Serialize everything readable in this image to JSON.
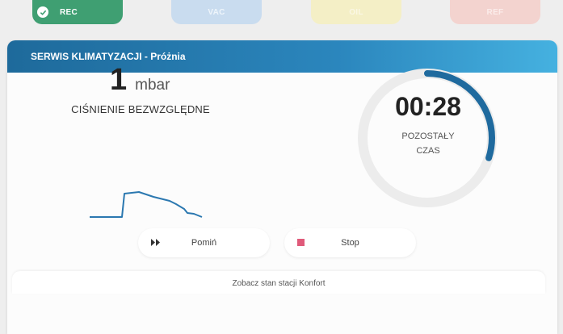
{
  "tabs": [
    {
      "label": "REC",
      "icon": "check-icon",
      "state": "active",
      "color": "#3f9f72"
    },
    {
      "label": "VAC",
      "state": "pending",
      "color": "#c9dcef"
    },
    {
      "label": "OIL",
      "state": "pending",
      "color": "#f4efc6"
    },
    {
      "label": "REF",
      "state": "pending",
      "color": "#f3d3cf"
    }
  ],
  "header": {
    "title": "SERWIS KLIMATYZACJI - Próżnia"
  },
  "pressure": {
    "value": "1",
    "unit": "mbar",
    "label": "CIŚNIENIE BEZWZGLĘDNE"
  },
  "timer": {
    "value": "00:28",
    "label_line1": "POZOSTAŁY",
    "label_line2": "CZAS",
    "progress_fraction": 0.3
  },
  "buttons": {
    "skip_label": "Pomiń",
    "stop_label": "Stop",
    "stop_icon_color": "#e05a7a"
  },
  "footer": {
    "link_label": "Zobacz stan stacji Konfort"
  },
  "colors": {
    "accent": "#1f6a9e",
    "graph": "#2b78b0"
  }
}
